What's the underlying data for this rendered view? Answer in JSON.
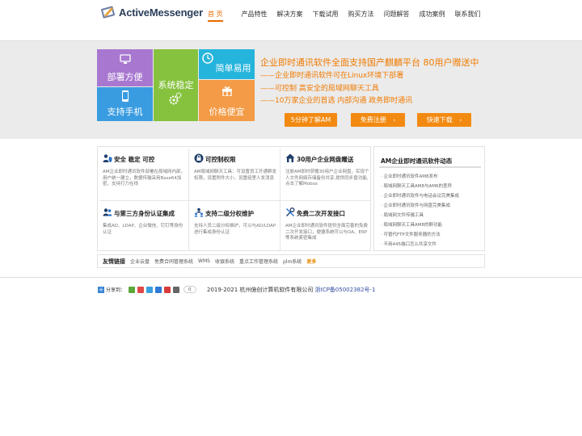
{
  "header": {
    "logo_text": "ActiveMessenger",
    "nav": [
      "首 页",
      "产品特性",
      "解决方案",
      "下载试用",
      "购买方法",
      "问题解答",
      "成功案例",
      "联系我们"
    ]
  },
  "banner": {
    "tiles": [
      "部署方便",
      "支持手机",
      "系统稳定",
      "简单易用",
      "价格便宜"
    ],
    "headline": "企业即时通讯软件全面支持国产麒麟平台 80用户赠送中",
    "bullets": [
      "——企业即时通讯软件可在Linux环境下部署",
      "——可控制 高安全的局域网聊天工具",
      "——10万家企业的首选 内部沟通 政务即时通讯"
    ],
    "ctas": [
      "5分钟了解AM",
      "免费注册",
      "快速下载"
    ]
  },
  "features": [
    {
      "title": "安全 稳定 可控",
      "desc": "AM企业即时通讯软件部署在局域网内部，用户统一建立，数据传输采用Base64加密，支持打力在线"
    },
    {
      "title": "可控制权限",
      "desc": "AM局域网聊天工具：可设置员工开通群发权限，设置附件大小，设置组里人发消息"
    },
    {
      "title": "30用户企业网盘赠送",
      "desc": "注册AM即时获赠30用户企业网盘，实现个人文件网络存储备份共享,提供同步盘功能,点击了解Mobox"
    },
    {
      "title": "与第三方身份认证集成",
      "desc": "集成AD、LDAP、企业微信、钉钉等身份认证"
    },
    {
      "title": "支持二级分权维护",
      "desc": "支持人员二级分权维护，可以与AD/LDAP进行集成身份认证"
    },
    {
      "title": "免费二次开发接口",
      "desc": "AM企业即时通讯软件提供全面完善的免费二次开发接口，便捷系统可以与OA、ERP等系统紧密集成"
    }
  ],
  "news": {
    "title": "AM企业即时通讯软件动态",
    "items": [
      "企业即时通讯软件AM8发布",
      "局域网聊天工具AM8与AM6的差异",
      "企业即时通讯软件与电话会议完美集成",
      "企业即时通讯软件与网盘完美集成",
      "局域网文件传输工具",
      "局域网聊天工具AM8的群功能",
      "可替代FTP文件服务器的方法",
      "不用445端口怎么共享文件"
    ]
  },
  "friend_links": {
    "title": "友情链接",
    "items": [
      "企业云盘",
      "免费合同管理系统",
      "WMS",
      "收银系统",
      "重点工作管理系统",
      "plm系统"
    ],
    "more": "更多"
  },
  "footer": {
    "share_label": "分享到：",
    "share_count": "0",
    "copyright": "2019-2021 杭州億创计算机软件有限公司",
    "icp": "浙ICP备05002382号-1"
  },
  "colors": {
    "accent": "#f28a12",
    "nav_active": "#e86b00",
    "headline": "#f07a00",
    "tile_purple": "#a878d0",
    "tile_blue": "#3a9ce0",
    "tile_green": "#86c23e",
    "tile_cyan": "#25b4dc",
    "tile_orange": "#f39b46"
  },
  "icons": {
    "features": [
      "shield-user-icon",
      "lock-key-icon",
      "home-network-icon",
      "users-icon",
      "users-tier-icon",
      "tools-icon"
    ],
    "tiles": [
      "monitor-icon",
      "phone-icon",
      "gears-icon",
      "clock-icon",
      "gift-icon"
    ]
  }
}
